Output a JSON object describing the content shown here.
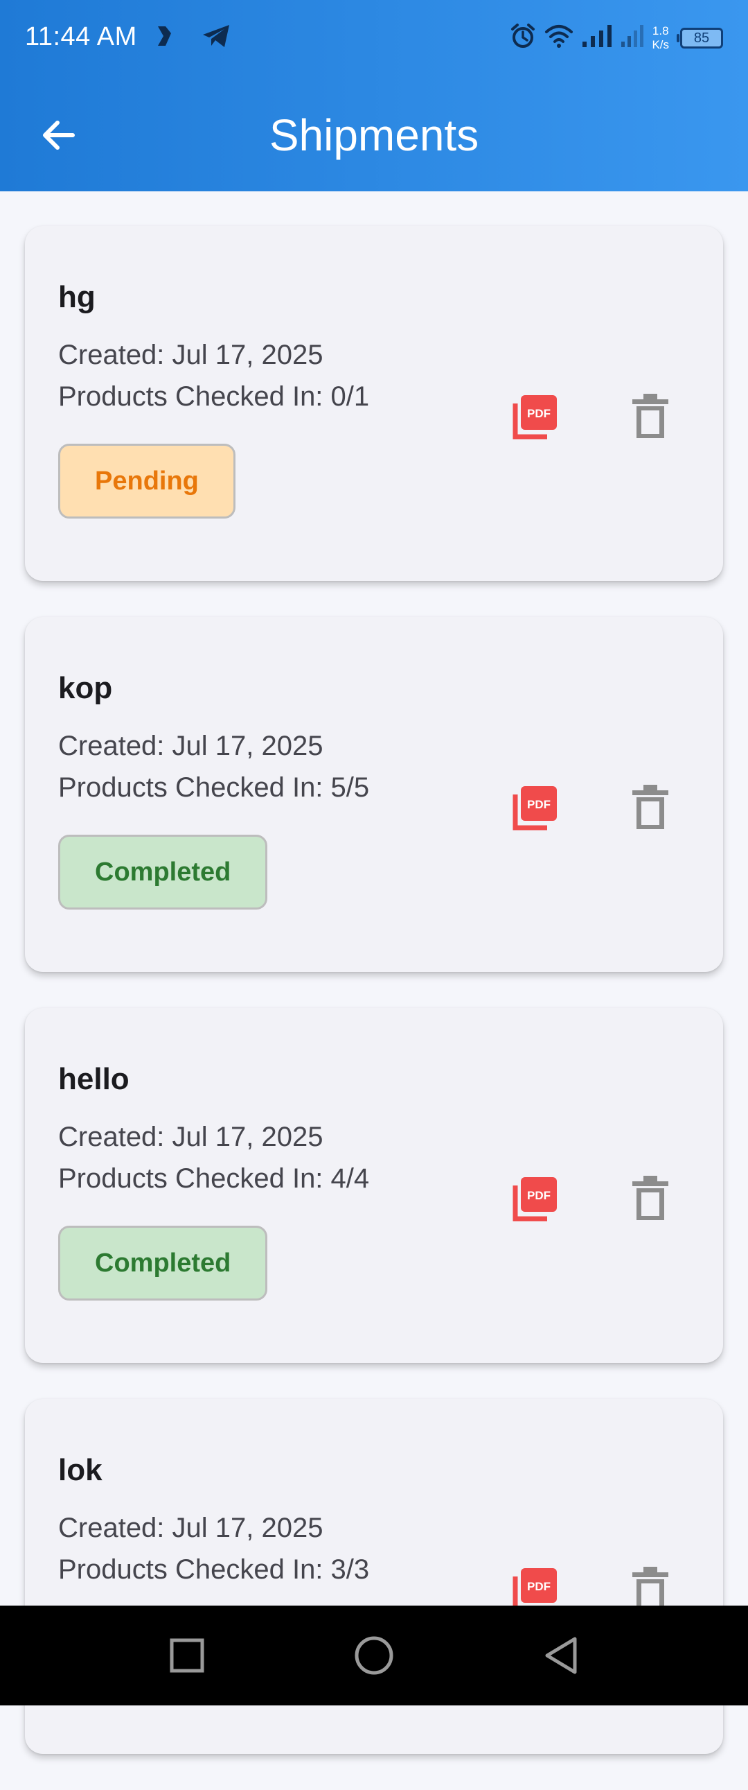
{
  "status_bar": {
    "time": "11:44 AM",
    "net_speed_value": "1.8",
    "net_speed_unit": "K/s",
    "battery": "85"
  },
  "header": {
    "title": "Shipments"
  },
  "shipments": [
    {
      "name": "hg",
      "created": "Created: Jul 17, 2025",
      "products_checked_in": "Products Checked In: 0/1",
      "status": "Pending"
    },
    {
      "name": "kop",
      "created": "Created: Jul 17, 2025",
      "products_checked_in": "Products Checked In: 5/5",
      "status": "Completed"
    },
    {
      "name": "hello",
      "created": "Created: Jul 17, 2025",
      "products_checked_in": "Products Checked In: 4/4",
      "status": "Completed"
    },
    {
      "name": "lok",
      "created": "Created: Jul 17, 2025",
      "products_checked_in": "Products Checked In: 3/3",
      "status": ""
    }
  ],
  "colors": {
    "app_bar_start": "#1f7ad6",
    "app_bar_end": "#3a97ef",
    "pdf_icon": "#f04b4b",
    "delete_icon": "#8c8c8c",
    "pending_bg": "#ffdfb1",
    "pending_text": "#e8770a",
    "completed_bg": "#c9e6cb",
    "completed_text": "#2c7a31"
  },
  "icons": {
    "back": "arrow-left-icon",
    "pdf": "pdf-icon",
    "delete": "trash-icon"
  }
}
